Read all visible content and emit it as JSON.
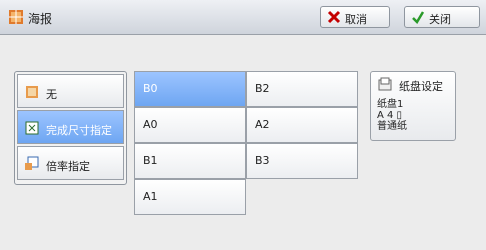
{
  "window": {
    "title": "海报"
  },
  "header": {
    "cancel_label": "取消",
    "close_label": "关闭"
  },
  "left_options": [
    {
      "label": "无"
    },
    {
      "label": "完成尺寸指定"
    },
    {
      "label": "倍率指定"
    }
  ],
  "sizes": {
    "col1": [
      "B0",
      "A0",
      "B1",
      "A1"
    ],
    "col2": [
      "B2",
      "A2",
      "B3"
    ]
  },
  "tray": {
    "button_label": "纸盘设定",
    "line1": "纸盘1",
    "line2": "A 4 ▯",
    "line3": "普通纸"
  }
}
